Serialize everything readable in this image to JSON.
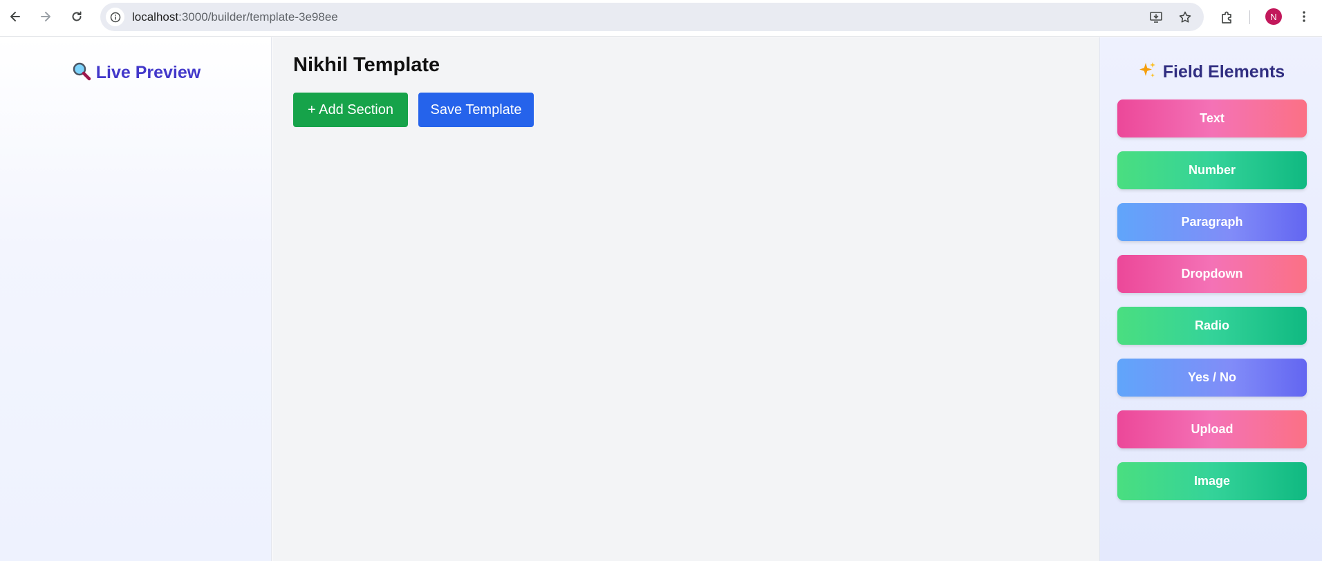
{
  "browser": {
    "url_host": "localhost",
    "url_path": ":3000/builder/template-3e98ee",
    "profile_initial": "N",
    "icons": {
      "back": "arrow-left-icon",
      "forward": "arrow-right-icon",
      "reload": "reload-icon",
      "site_info": "info-icon",
      "install": "install-app-icon",
      "bookmark": "star-icon",
      "extensions": "puzzle-icon",
      "menu": "kebab-menu-icon"
    }
  },
  "preview": {
    "icon": "magnifier-icon",
    "title": "Live Preview"
  },
  "main": {
    "template_name": "Nikhil Template",
    "add_section_label": "+ Add Section",
    "save_template_label": "Save Template",
    "colors": {
      "add": "#16a34a",
      "save": "#2563eb"
    }
  },
  "fields": {
    "icon": "sparkles-icon",
    "title": "Field Elements",
    "items": [
      {
        "label": "Text",
        "style": "pink"
      },
      {
        "label": "Number",
        "style": "green"
      },
      {
        "label": "Paragraph",
        "style": "blue"
      },
      {
        "label": "Dropdown",
        "style": "pink"
      },
      {
        "label": "Radio",
        "style": "green"
      },
      {
        "label": "Yes / No",
        "style": "blue"
      },
      {
        "label": "Upload",
        "style": "pink"
      },
      {
        "label": "Image",
        "style": "green"
      }
    ]
  }
}
